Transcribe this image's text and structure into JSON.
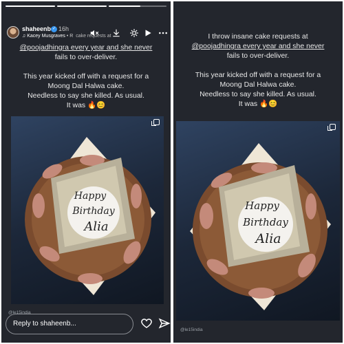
{
  "left": {
    "header": {
      "username": "shaheenb",
      "verified": true,
      "time": "16h",
      "music": "Kacey Musgraves",
      "music_suffix": "• R",
      "overlap_text": "cake requests at"
    },
    "progress": [
      1,
      1,
      0.55
    ],
    "story_lines": [
      "@poojadhingra every year and she never",
      "fails to over-deliver.",
      "",
      "This year kicked off with a request for a",
      "Moong Dal Halwa cake.",
      "Needless to say she killed. As usual.",
      "It was 🔥😊"
    ],
    "credit": "@le15india",
    "reply_placeholder": "Reply to shaheenb...",
    "cake_text": [
      "Happy",
      "Birthday",
      "Alia"
    ],
    "icons": [
      "mute-icon",
      "download-icon",
      "gear-icon",
      "play-icon",
      "more-icon",
      "heart-icon",
      "send-icon"
    ]
  },
  "right": {
    "story_lines": [
      "I throw insane cake requests at",
      "@poojadhingra every year and she never",
      "fails to over-deliver.",
      "",
      "This year kicked off with a request for a",
      "Moong Dal Halwa cake.",
      "Needless to say she killed. As usual.",
      "It was 🔥😊"
    ],
    "credit": "@le15india",
    "cake_text": [
      "Happy",
      "Birthday",
      "Alia"
    ]
  },
  "colors": {
    "panel_bg": "#23262d",
    "text": "#e8e8e8",
    "photo_bg": "#1c2739"
  }
}
